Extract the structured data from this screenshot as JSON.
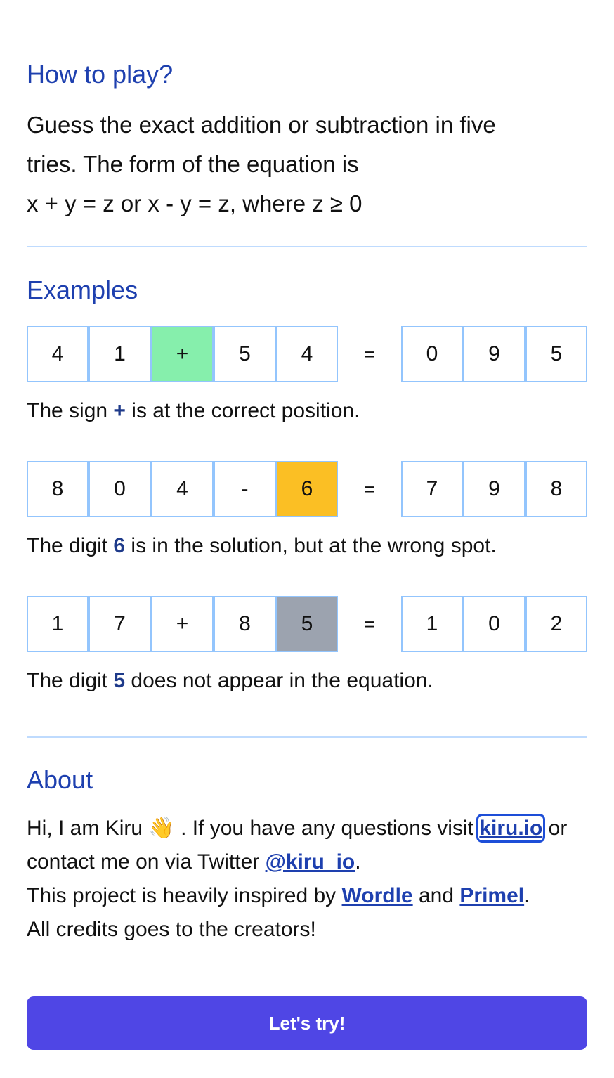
{
  "howto": {
    "title": "How to play?",
    "line1": "Guess the exact addition or subtraction in five",
    "line2": "tries. The form of the equation is",
    "line3": "x + y = z or x - y = z, where z ≥ 0"
  },
  "examples": {
    "title": "Examples",
    "rows": [
      {
        "tiles": [
          "4",
          "1",
          "+",
          "5",
          "4"
        ],
        "equals": "=",
        "result": [
          "0",
          "9",
          "5"
        ],
        "desc_pre": "The sign ",
        "desc_bold": "+",
        "desc_post": " is at the correct position."
      },
      {
        "tiles": [
          "8",
          "0",
          "4",
          "-",
          "6"
        ],
        "equals": "=",
        "result": [
          "7",
          "9",
          "8"
        ],
        "desc_pre": "The digit ",
        "desc_bold": "6",
        "desc_post": " is in the solution, but at the wrong spot."
      },
      {
        "tiles": [
          "1",
          "7",
          "+",
          "8",
          "5"
        ],
        "equals": "=",
        "result": [
          "1",
          "0",
          "2"
        ],
        "desc_pre": "The digit ",
        "desc_bold": "5",
        "desc_post": " does not appear in the equation."
      }
    ]
  },
  "colors": {
    "correct": "#86efac",
    "present": "#fbbf24",
    "absent": "#9ca3af",
    "accent": "#1e40af",
    "button": "#4f46e5"
  },
  "about": {
    "title": "About",
    "t1": "Hi, I am Kiru ",
    "wave": "👋",
    "t2": " . If you have any questions visit ",
    "link_kiru": "kiru.io",
    "t3": " or contact me on via Twitter ",
    "link_twitter": "@kiru_io",
    "t4": ".",
    "t5": "This project is heavily inspired by ",
    "link_wordle": "Wordle",
    "t6": " and ",
    "link_primel": "Primel",
    "t7": ".",
    "t8": "All credits goes to the creators!"
  },
  "button": {
    "label": "Let's try!"
  }
}
